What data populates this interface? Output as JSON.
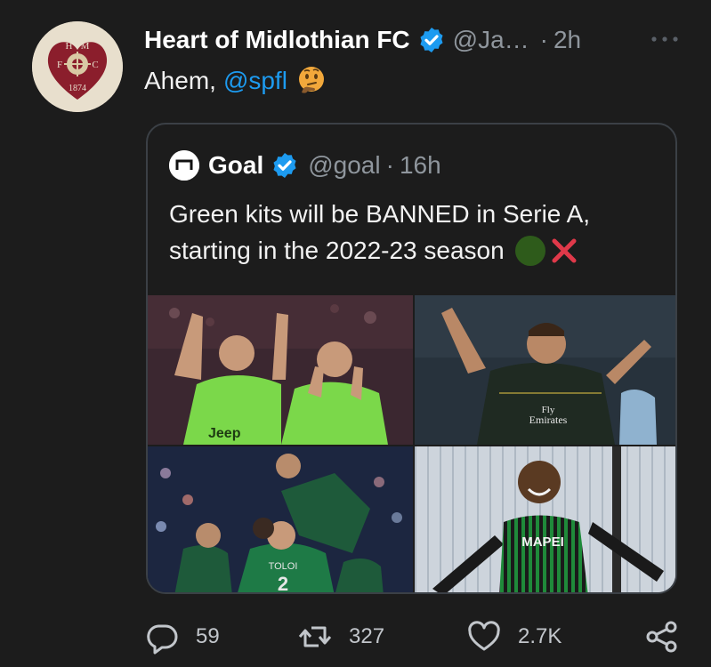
{
  "tweet": {
    "author_name": "Heart of Midlothian FC",
    "handle": "@Ja…",
    "separator": "·",
    "time": "2h",
    "text_prefix": "Ahem,",
    "mention": "@spfl",
    "avatar_letters": {
      "top": "H · M",
      "left": "F",
      "right": "C",
      "year": "1874"
    }
  },
  "quoted": {
    "author_name": "Goal",
    "handle": "@goal",
    "separator": "·",
    "time": "16h",
    "line1": "Green kits will be BANNED in Serie A,",
    "line2": "starting in the 2022-23 season",
    "photos": [
      {
        "name": "photo-1",
        "jersey_text": "Jeep"
      },
      {
        "name": "photo-2",
        "jersey_text": "Fly Emirates",
        "jersey_text_1": "Fly",
        "jersey_text_2": "Emirates"
      },
      {
        "name": "photo-3",
        "jersey_text": "TOLOI",
        "number": "2"
      },
      {
        "name": "photo-4",
        "jersey_text": "MAPEI"
      }
    ]
  },
  "actions": {
    "replies": "59",
    "retweets": "327",
    "likes": "2.7K"
  },
  "colors": {
    "background": "#1c1c1c",
    "link": "#1d9bf0",
    "verified": "#1d9bf0",
    "muted": "#8f969d",
    "border": "#3b4046"
  }
}
